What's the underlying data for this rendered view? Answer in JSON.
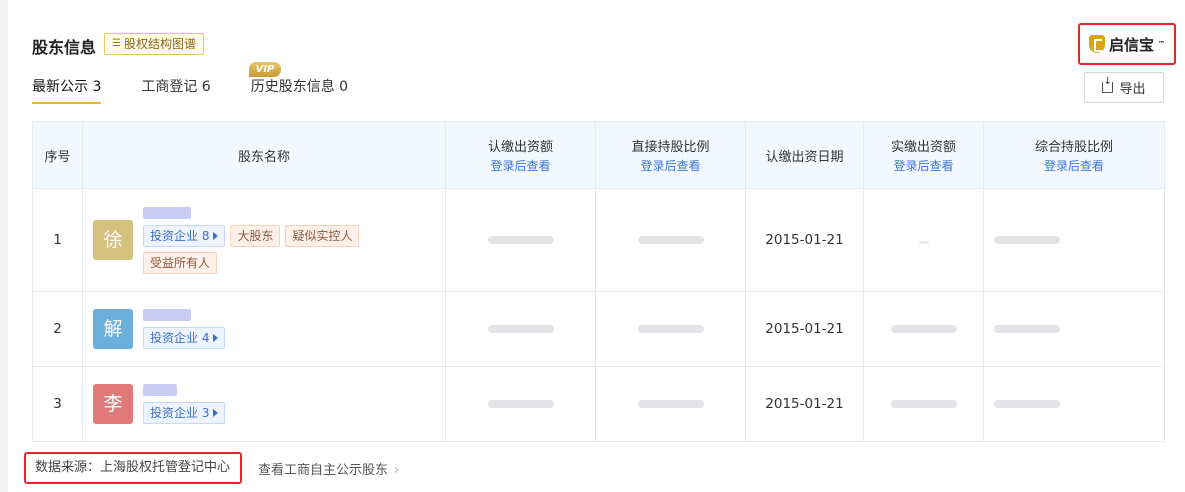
{
  "header": {
    "title": "股东信息",
    "chart_link": "股权结构图谱",
    "brand": "启信宝",
    "brand_tm": "™",
    "export_label": "导出"
  },
  "tabs": [
    {
      "label": "最新公示 3",
      "active": true
    },
    {
      "label": "工商登记 6",
      "active": false
    },
    {
      "label": "历史股东信息 0",
      "active": false
    }
  ],
  "vip_badge": "VIP",
  "table": {
    "headers": {
      "seq": "序号",
      "name": "股东名称",
      "subscribed": "认缴出资额",
      "direct_ratio": "直接持股比例",
      "sub_date": "认缴出资日期",
      "paid": "实缴出资额",
      "total_ratio": "综合持股比例",
      "login_hint": "登录后查看"
    },
    "rows": [
      {
        "seq": "1",
        "avatar": "徐",
        "avatar_color": "#d6c07e",
        "invest": "投资企业 8",
        "tags": [
          "大股东",
          "疑似实控人",
          "受益所有人"
        ],
        "date": "2015-01-21"
      },
      {
        "seq": "2",
        "avatar": "解",
        "avatar_color": "#6aaedb",
        "invest": "投资企业 4",
        "tags": [],
        "date": "2015-01-21"
      },
      {
        "seq": "3",
        "avatar": "李",
        "avatar_color": "#e07a7a",
        "invest": "投资企业 3",
        "tags": [],
        "date": "2015-01-21"
      }
    ]
  },
  "footer": {
    "source": "数据来源：上海股权托管登记中心",
    "more_link": "查看工商自主公示股东"
  }
}
